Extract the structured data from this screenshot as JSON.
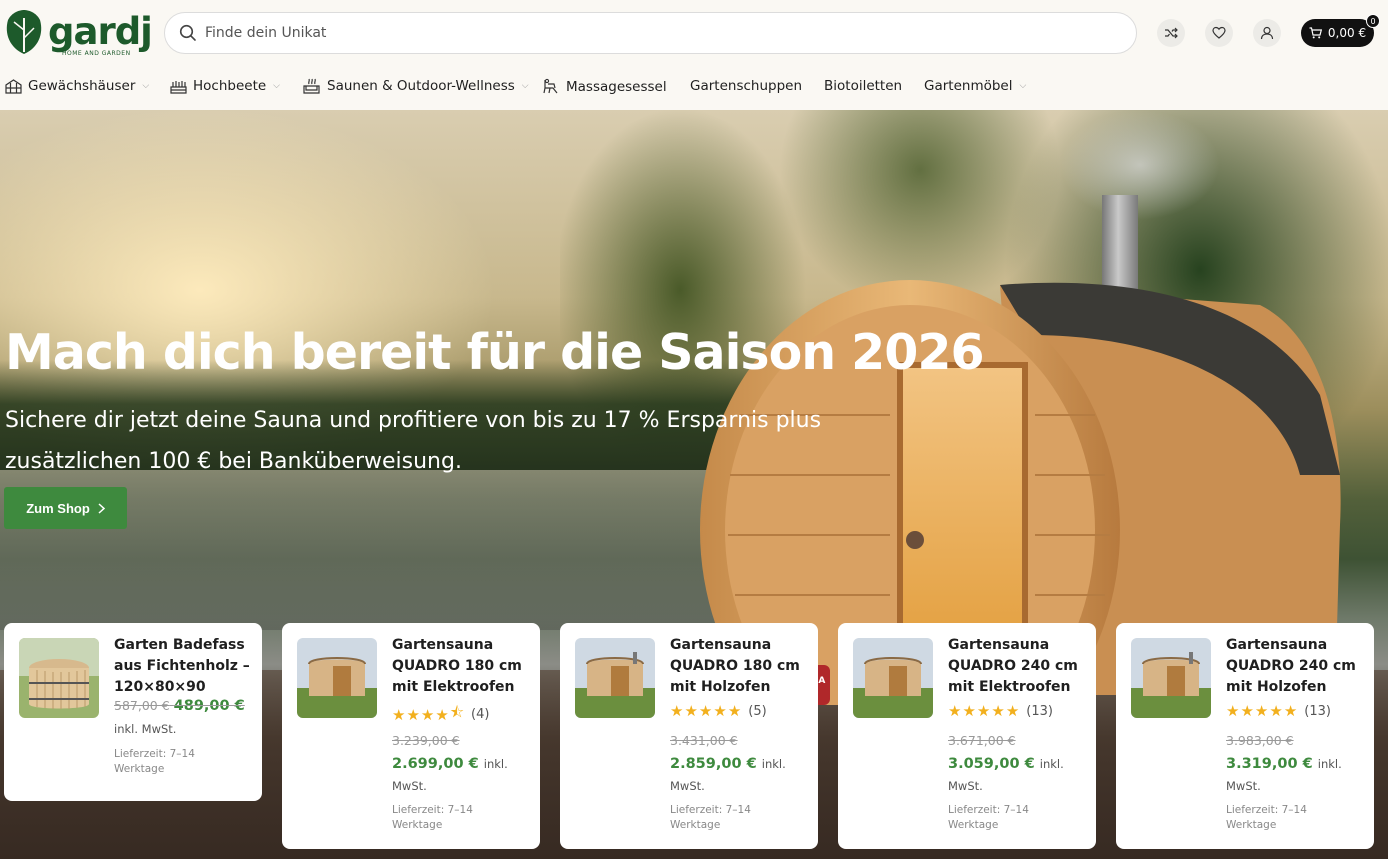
{
  "brand": {
    "name": "gardj",
    "tagline": "HOME AND GARDEN",
    "color": "#1d5a2b"
  },
  "search": {
    "placeholder": "Finde dein Unikat"
  },
  "header_icons": [
    "shuffle-icon",
    "heart-icon",
    "user-icon"
  ],
  "cart": {
    "total": "0,00 €",
    "count": "0"
  },
  "nav": [
    {
      "label": "Gewächshäuser",
      "icon": "greenhouse-icon",
      "dropdown": true
    },
    {
      "label": "Hochbeete",
      "icon": "raised-bed-icon",
      "dropdown": true
    },
    {
      "label": "Saunen & Outdoor-Wellness",
      "icon": "sauna-icon",
      "dropdown": true
    },
    {
      "label": "Massagesessel",
      "icon": "massage-chair-icon",
      "dropdown": false
    },
    {
      "label": "Gartenschuppen",
      "icon": "",
      "dropdown": false
    },
    {
      "label": "Biotoiletten",
      "icon": "",
      "dropdown": false
    },
    {
      "label": "Gartenmöbel",
      "icon": "",
      "dropdown": true
    }
  ],
  "hero": {
    "title": "Mach dich bereit für die Saison 2026",
    "subtitle": "Sichere dir jetzt deine Sauna und profitiere von bis zu 17 % Ersparnis plus zusätzlichen 100 € bei Banküberweisung.",
    "button": "Zum Shop",
    "stove_brand": "HARVIA"
  },
  "products": [
    {
      "name": "Garten Badefass aus Fichtenholz – 120×80×90",
      "rating": null,
      "reviews": "",
      "old_price": "587,00 €",
      "price": "489,00 €",
      "tax": "inkl. MwSt.",
      "delivery": "Lieferzeit: 7–14 Werktage"
    },
    {
      "name": "Gartensauna QUADRO 180 cm mit Elektroofen",
      "rating": 4.5,
      "reviews": "(4)",
      "old_price": "3.239,00 €",
      "price": "2.699,00 €",
      "tax": "inkl. MwSt.",
      "delivery": "Lieferzeit: 7–14 Werktage"
    },
    {
      "name": "Gartensauna QUADRO 180 cm mit Holzofen",
      "rating": 5,
      "reviews": "(5)",
      "old_price": "3.431,00 €",
      "price": "2.859,00 €",
      "tax": "inkl. MwSt.",
      "delivery": "Lieferzeit: 7–14 Werktage"
    },
    {
      "name": "Gartensauna QUADRO 240 cm mit Elektroofen",
      "rating": 5,
      "reviews": "(13)",
      "old_price": "3.671,00 €",
      "price": "3.059,00 €",
      "tax": "inkl. MwSt.",
      "delivery": "Lieferzeit: 7–14 Werktage"
    },
    {
      "name": "Gartensauna QUADRO 240 cm mit Holzofen",
      "rating": 5,
      "reviews": "(13)",
      "old_price": "3.983,00 €",
      "price": "3.319,00 €",
      "tax": "inkl. MwSt.",
      "delivery": "Lieferzeit: 7–14 Werktage"
    }
  ],
  "colors": {
    "accent_green": "#3e8a3e",
    "star": "#f2b01e",
    "background": "#faf8f3"
  }
}
